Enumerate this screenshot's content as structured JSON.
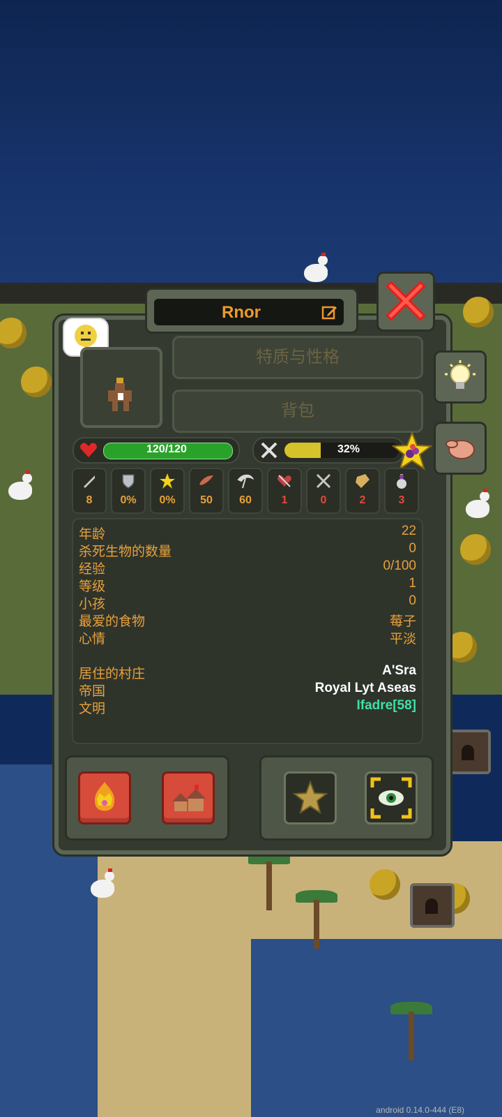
{
  "unit": {
    "name": "Rnor",
    "buttons": {
      "traits": "特质与性格",
      "inventory": "背包"
    },
    "health": {
      "text": "120/120",
      "fraction": 1.0
    },
    "hunger": {
      "text": "32%",
      "fraction": 0.32
    },
    "stats": [
      {
        "icon": "sword-icon",
        "value": "8",
        "color": "#e8a03a"
      },
      {
        "icon": "shield-icon",
        "value": "0%",
        "color": "#e8a03a"
      },
      {
        "icon": "crit-star-icon",
        "value": "0%",
        "color": "#e8a03a"
      },
      {
        "icon": "speed-wing-icon",
        "value": "50",
        "color": "#e8a03a"
      },
      {
        "icon": "scythe-icon",
        "value": "60",
        "color": "#e8a03a"
      },
      {
        "icon": "kill-heart-icon",
        "value": "1",
        "color": "#e04a3a"
      },
      {
        "icon": "crossed-swords-icon",
        "value": "0",
        "color": "#e04a3a"
      },
      {
        "icon": "scroll-icon",
        "value": "2",
        "color": "#e04a3a"
      },
      {
        "icon": "potion-icon",
        "value": "3",
        "color": "#e04a3a"
      }
    ],
    "info": {
      "age_label": "年龄",
      "age": "22",
      "kills_label": "杀死生物的数量",
      "kills": "0",
      "exp_label": "经验",
      "exp": "0/100",
      "level_label": "等级",
      "level": "1",
      "children_label": "小孩",
      "children": "0",
      "food_label": "最爱的食物",
      "food": "莓子",
      "mood_label": "心情",
      "mood": "平淡",
      "village_label": "居住的村庄",
      "village": "A'Sra",
      "kingdom_label": "帝国",
      "kingdom": "Royal Lyt Aseas",
      "culture_label": "文明",
      "culture": "Ifadre[58]"
    }
  },
  "colors": {
    "accent": "#ef9a2a",
    "teal": "#3fe0a6",
    "panel": "#343a30"
  },
  "footer": {
    "version": "android 0.14.0-444 (E8)"
  }
}
